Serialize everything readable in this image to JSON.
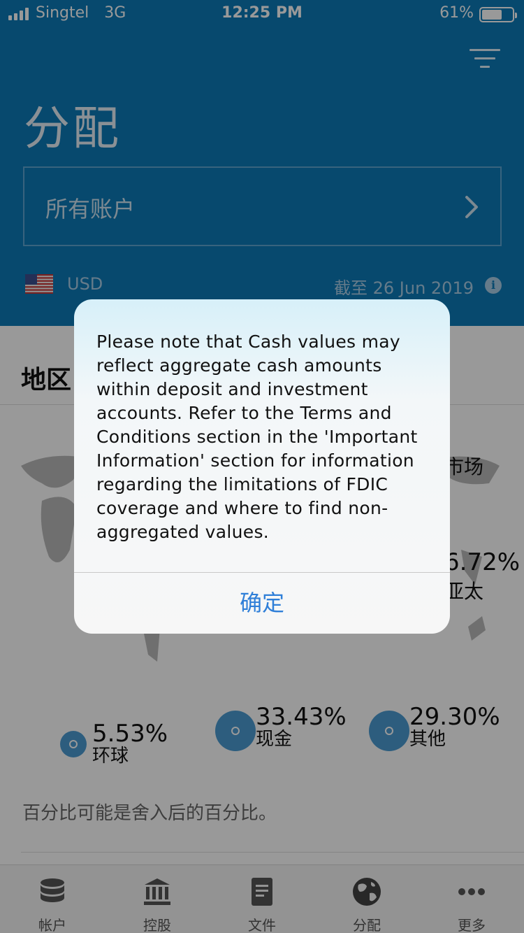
{
  "status_bar": {
    "carrier": "Singtel",
    "network": "3G",
    "time": "12:25 PM",
    "battery": "61%",
    "battery_level": 0.61
  },
  "header": {
    "title": "分配",
    "account_selector": "所有账户",
    "currency": "USD",
    "as_of": "截至 26 Jun 2019",
    "icons": [
      "filter-icon",
      "chevron-right-icon",
      "us-flag-icon",
      "info-icon"
    ]
  },
  "content": {
    "section_title": "地区",
    "map_labels": [
      {
        "name": "市场",
        "pct": ""
      },
      {
        "name": "亚太",
        "pct": "6.72%"
      }
    ],
    "legend": [
      {
        "pct": "5.53%",
        "name": "环球"
      },
      {
        "pct": "33.43%",
        "name": "现金"
      },
      {
        "pct": "29.30%",
        "name": "其他"
      }
    ],
    "footnote": "百分比可能是舍入后的百分比。"
  },
  "tabs": [
    {
      "label": "帐户",
      "icon": "database-icon"
    },
    {
      "label": "控股",
      "icon": "bank-icon"
    },
    {
      "label": "文件",
      "icon": "document-icon"
    },
    {
      "label": "分配",
      "icon": "globe-icon"
    },
    {
      "label": "更多",
      "icon": "more-icon"
    }
  ],
  "alert": {
    "message": "Please note that Cash values may reflect aggregate cash amounts within deposit and investment accounts. Refer to the Terms and Conditions section in the 'Important Information' section for information regarding the limitations of FDIC coverage and where to find non-aggregated values.",
    "confirm_label": "确定"
  },
  "colors": {
    "header_blue": "#0d7ab8",
    "accent_blue": "#4b9cd3",
    "alert_button": "#2f7fd8"
  }
}
